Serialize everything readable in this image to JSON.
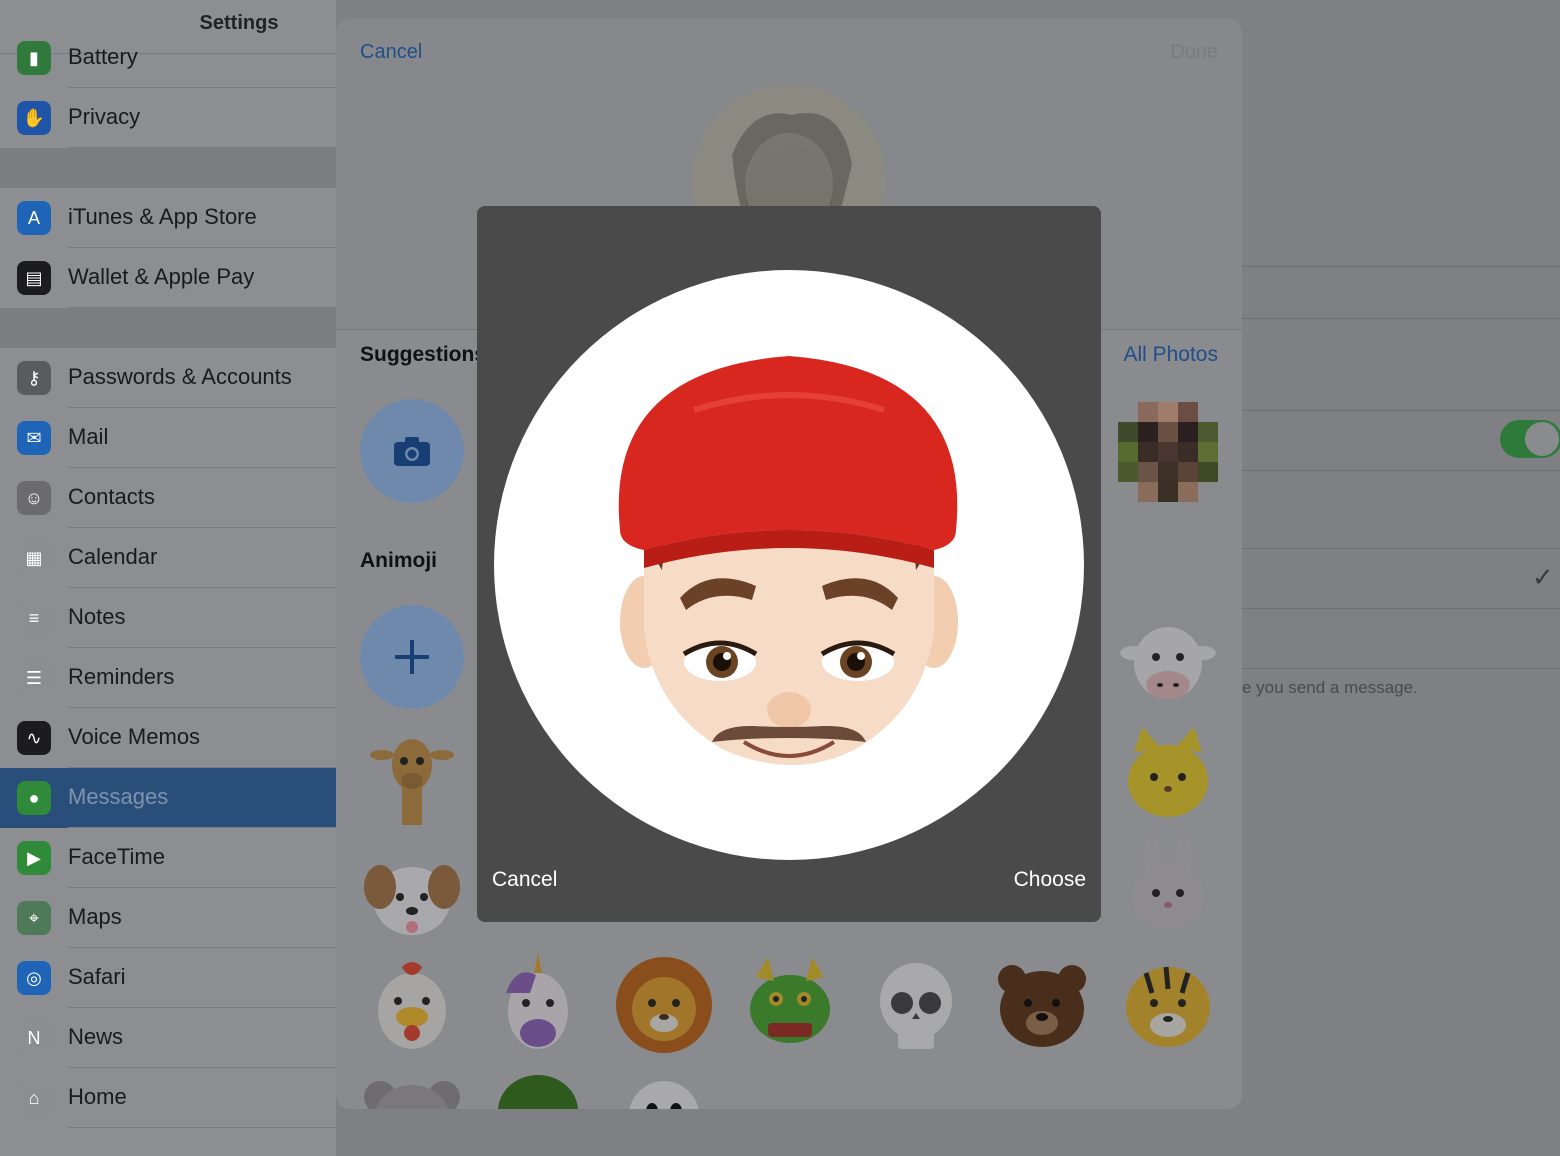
{
  "sidebar": {
    "title": "Settings",
    "items": [
      {
        "label": "Battery",
        "icon": "battery-icon",
        "color": "#2f7a3c"
      },
      {
        "label": "Privacy",
        "icon": "hand-icon",
        "color": "#1f55a8"
      },
      {
        "label": "iTunes & App Store",
        "icon": "app-store-icon",
        "color": "#1f64b6"
      },
      {
        "label": "Wallet & Apple Pay",
        "icon": "wallet-icon",
        "color": "#1c1c1e"
      },
      {
        "label": "Passwords & Accounts",
        "icon": "key-icon",
        "color": "#5a5b5f"
      },
      {
        "label": "Mail",
        "icon": "mail-icon",
        "color": "#1f64b6"
      },
      {
        "label": "Contacts",
        "icon": "contacts-icon",
        "color": "#6b6b6f"
      },
      {
        "label": "Calendar",
        "icon": "calendar-icon",
        "color": "#8c8d91"
      },
      {
        "label": "Notes",
        "icon": "notes-icon",
        "color": "#8c8d91"
      },
      {
        "label": "Reminders",
        "icon": "reminders-icon",
        "color": "#8c8d91"
      },
      {
        "label": "Voice Memos",
        "icon": "voice-memos-icon",
        "color": "#1c1c1e"
      },
      {
        "label": "Messages",
        "icon": "messages-icon",
        "color": "#2f8a3a",
        "selected": true
      },
      {
        "label": "FaceTime",
        "icon": "facetime-icon",
        "color": "#2f8a3a"
      },
      {
        "label": "Maps",
        "icon": "maps-icon",
        "color": "#4f7a5a"
      },
      {
        "label": "Safari",
        "icon": "safari-icon",
        "color": "#1f64b6"
      },
      {
        "label": "News",
        "icon": "news-icon",
        "color": "#8c8d91"
      },
      {
        "label": "Home",
        "icon": "home-icon",
        "color": "#8c8d91"
      }
    ]
  },
  "detail": {
    "footer_note": "e you send a message."
  },
  "sheet": {
    "cancel": "Cancel",
    "done": "Done",
    "suggestions": "Suggestions",
    "all_photos": "All Photos",
    "animoji": "Animoji",
    "animoji_faces": [
      "giraffe",
      "dog",
      "chicken",
      "unicorn",
      "lion",
      "dragon",
      "skull",
      "bear",
      "tiger",
      "koala",
      "lizard",
      "ghost",
      "cow",
      "cat",
      "rabbit"
    ]
  },
  "crop": {
    "cancel": "Cancel",
    "choose": "Choose"
  },
  "colors": {
    "accent": "#1e4f8a",
    "selected_row": "#2a4e7a",
    "memoji_hat": "#d8271f"
  }
}
